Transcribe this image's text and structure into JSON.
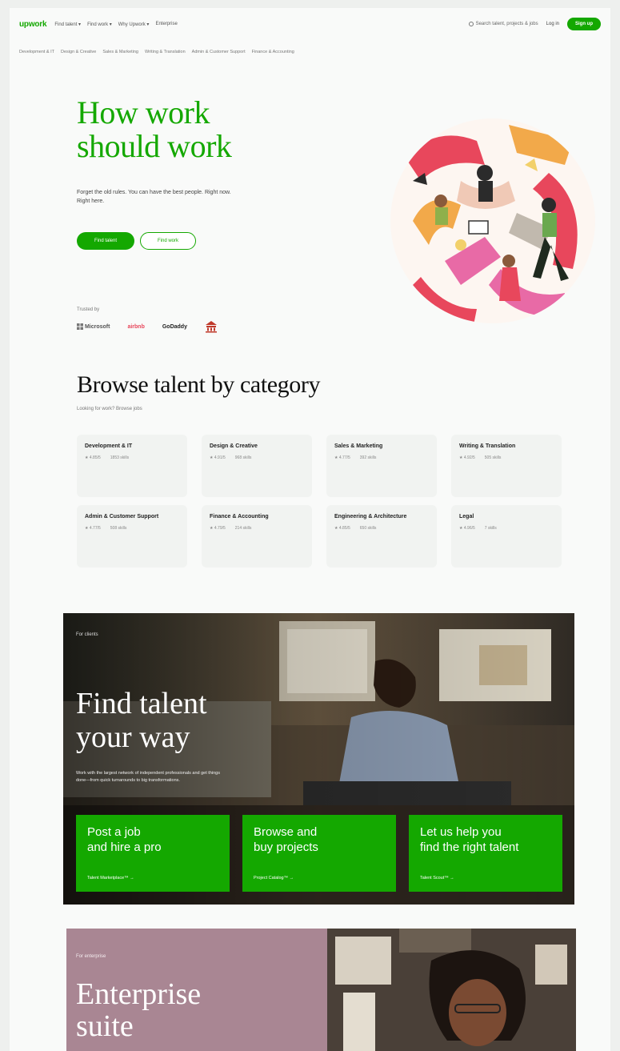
{
  "nav": {
    "logo": "upwork",
    "menu": [
      "Find talent ▾",
      "Find work ▾",
      "Why Upwork ▾",
      "Enterprise"
    ],
    "search_placeholder": "Search talent, projects & jobs",
    "login": "Log in",
    "signup": "Sign up"
  },
  "subnav": [
    "Development & IT",
    "Design & Creative",
    "Sales & Marketing",
    "Writing & Translation",
    "Admin & Customer Support",
    "Finance & Accounting"
  ],
  "hero": {
    "title_line1": "How work",
    "title_line2": "should work",
    "subtitle": "Forget the old rules. You can have the best people. Right now. Right here.",
    "primary_cta": "Find talent",
    "secondary_cta": "Find work",
    "trusted_label": "Trusted by",
    "logos": [
      "Microsoft",
      "airbnb",
      "GoDaddy"
    ]
  },
  "browse": {
    "title": "Browse talent by category",
    "subtitle": "Looking for work? Browse jobs",
    "categories": [
      {
        "name": "Development & IT",
        "rating": "★ 4.85/5",
        "skills": "1853 skills"
      },
      {
        "name": "Design & Creative",
        "rating": "★ 4.91/5",
        "skills": "968 skills"
      },
      {
        "name": "Sales & Marketing",
        "rating": "★ 4.77/5",
        "skills": "392 skills"
      },
      {
        "name": "Writing & Translation",
        "rating": "★ 4.92/5",
        "skills": "505 skills"
      },
      {
        "name": "Admin & Customer Support",
        "rating": "★ 4.77/5",
        "skills": "508 skills"
      },
      {
        "name": "Finance & Accounting",
        "rating": "★ 4.79/5",
        "skills": "214 skills"
      },
      {
        "name": "Engineering & Architecture",
        "rating": "★ 4.85/5",
        "skills": "650 skills"
      },
      {
        "name": "Legal",
        "rating": "★ 4.96/5",
        "skills": "7 skills"
      }
    ]
  },
  "find": {
    "label": "For clients",
    "title_line1": "Find talent",
    "title_line2": "your way",
    "description": "Work with the largest network of independent professionals and get things done—from quick turnarounds to big transformations.",
    "cards": [
      {
        "line1": "Post a job",
        "line2": "and hire a pro",
        "link": "Talent Marketplace™ →"
      },
      {
        "line1": "Browse and",
        "line2": "buy projects",
        "link": "Project Catalog™ →"
      },
      {
        "line1": "Let us help you",
        "line2": "find the right talent",
        "link": "Talent Scout™ →"
      }
    ]
  },
  "enterprise": {
    "label": "For enterprise",
    "title_line1": "Enterprise",
    "title_line2": "suite"
  },
  "colors": {
    "brand_green": "#14a800",
    "enterprise_mauve": "#a98693"
  }
}
